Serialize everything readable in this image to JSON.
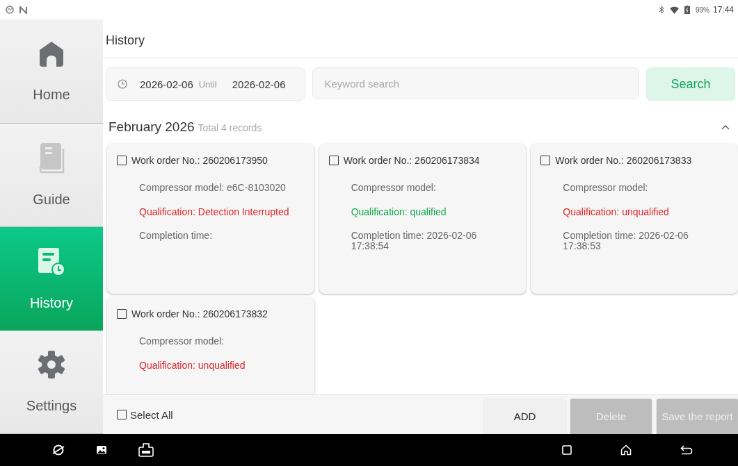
{
  "status_bar": {
    "battery": "99%",
    "time": "17:44"
  },
  "sidebar": {
    "items": [
      {
        "label": "Home",
        "kind": "home",
        "selected": false
      },
      {
        "label": "Guide",
        "kind": "guide",
        "selected": false
      },
      {
        "label": "History",
        "kind": "history",
        "selected": true
      },
      {
        "label": "Settings",
        "kind": "settings",
        "selected": false
      }
    ]
  },
  "page_title": "History",
  "filter": {
    "date_from": "2026-02-06",
    "until": "Until",
    "date_to": "2026-02-06",
    "search_placeholder": "Keyword search",
    "search_button": "Search"
  },
  "group": {
    "title": "February 2026",
    "count": "Total 4 records",
    "expanded": true
  },
  "records": [
    {
      "work_order": "Work order No.: 260206173950",
      "checked": false,
      "compressor": "Compressor model: e6C-8103020",
      "qualification": "Qualification: Detection Interrupted",
      "kind": "interrupted",
      "completion": "Completion time:"
    },
    {
      "work_order": "Work order No.: 260206173834",
      "checked": false,
      "compressor": "Compressor model:",
      "qualification": "Qualification: qualified",
      "kind": "qualified",
      "completion": "Completion time: 2026-02-06 17:38:54"
    },
    {
      "work_order": "Work order No.: 260206173833",
      "checked": false,
      "compressor": "Compressor model:",
      "qualification": "Qualification: unqualified",
      "kind": "unqualified",
      "completion": "Completion time: 2026-02-06 17:38:53"
    },
    {
      "work_order": "Work order No.: 260206173832",
      "checked": false,
      "compressor": "Compressor model:",
      "qualification": "Qualification: unqualified",
      "kind": "unqualified"
    }
  ],
  "footer": {
    "select_all": "Select All",
    "select_all_checked": false,
    "buttons": [
      {
        "label": "ADD",
        "disabled": false
      },
      {
        "label": "Delete",
        "disabled": true
      },
      {
        "label": "Save the report",
        "disabled": true
      }
    ]
  }
}
